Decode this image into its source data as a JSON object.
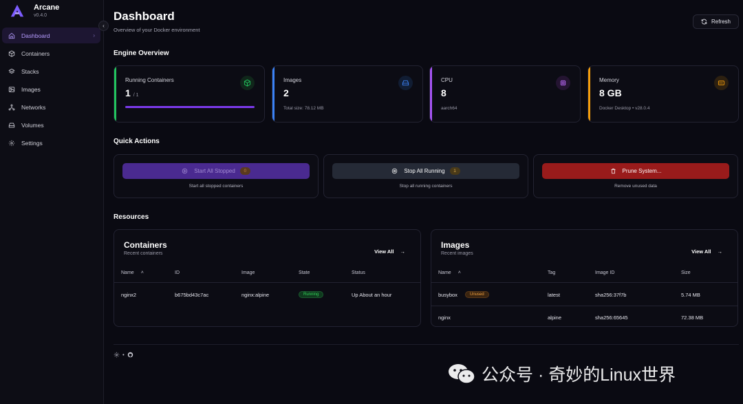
{
  "brand": {
    "name": "Arcane",
    "version": "v0.4.0"
  },
  "sidebar": {
    "items": [
      {
        "label": "Dashboard",
        "icon": "home-icon",
        "active": true
      },
      {
        "label": "Containers",
        "icon": "box-icon"
      },
      {
        "label": "Stacks",
        "icon": "layers-icon"
      },
      {
        "label": "Images",
        "icon": "image-icon"
      },
      {
        "label": "Networks",
        "icon": "network-icon"
      },
      {
        "label": "Volumes",
        "icon": "drive-icon"
      },
      {
        "label": "Settings",
        "icon": "gear-icon"
      }
    ]
  },
  "header": {
    "title": "Dashboard",
    "subtitle": "Overview of your Docker environment",
    "refresh_label": "Refresh"
  },
  "engine": {
    "title": "Engine Overview",
    "running": {
      "label": "Running Containers",
      "value": "1",
      "total": "/ 1",
      "progress_pct": 100,
      "color": "#22c55e"
    },
    "images": {
      "label": "Images",
      "value": "2",
      "detail": "Total size: 78.12 MB",
      "color": "#3b82f6"
    },
    "cpu": {
      "label": "CPU",
      "value": "8",
      "detail": "aarch64",
      "color": "#a855f7"
    },
    "memory": {
      "label": "Memory",
      "value": "8 GB",
      "detail": "Docker Desktop  • v28.0.4",
      "color": "#f59e0b"
    }
  },
  "quick_actions": {
    "title": "Quick Actions",
    "start": {
      "label": "Start All Stopped",
      "badge": "0",
      "desc": "Start all stopped containers"
    },
    "stop": {
      "label": "Stop All Running",
      "badge": "1",
      "desc": "Stop all running containers"
    },
    "prune": {
      "label": "Prune System...",
      "desc": "Remove unused data"
    }
  },
  "resources": {
    "title": "Resources",
    "containers": {
      "title": "Containers",
      "subtitle": "Recent containers",
      "view_all": "View All",
      "columns": [
        "Name",
        "ID",
        "Image",
        "State",
        "Status"
      ],
      "rows": [
        {
          "name": "nginx2",
          "id": "b675bd43c7ac",
          "image": "nginx:alpine",
          "state": "Running",
          "status": "Up About an hour"
        }
      ]
    },
    "images": {
      "title": "Images",
      "subtitle": "Recent images",
      "view_all": "View All",
      "columns": [
        "Name",
        "Tag",
        "Image ID",
        "Size"
      ],
      "rows": [
        {
          "name": "busybox",
          "badge": "Unused",
          "tag": "latest",
          "image_id": "sha256:37f7b",
          "size": "5.74 MB"
        },
        {
          "name": "nginx",
          "badge": "",
          "tag": "alpine",
          "image_id": "sha256:65645",
          "size": "72.38 MB"
        }
      ]
    }
  },
  "footer": {
    "separator": "•"
  },
  "watermark": {
    "text": "公众号 · 奇妙的Linux世界"
  },
  "colors": {
    "accent": "#7c3aed",
    "danger": "#991b1b",
    "background": "#0a0a12"
  }
}
